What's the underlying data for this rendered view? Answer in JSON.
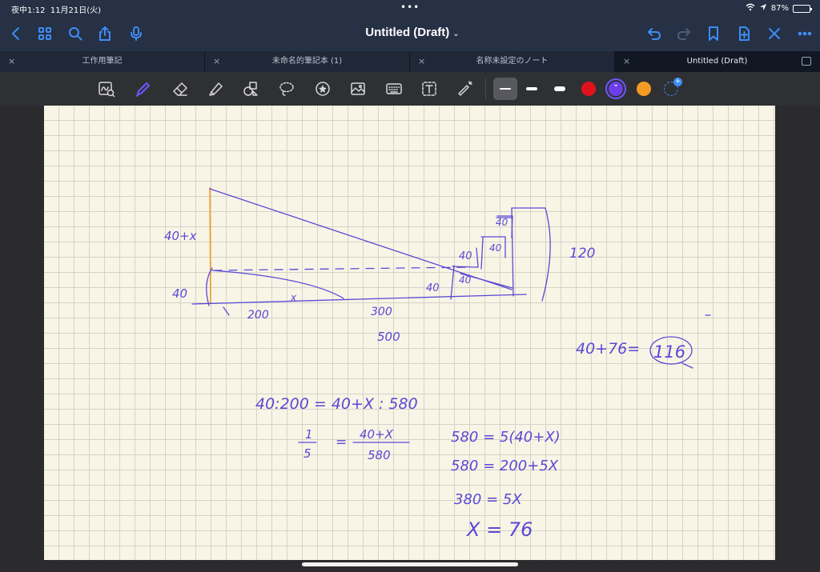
{
  "status": {
    "time": "夜中1:12",
    "date": "11月21日(火)",
    "battery": "87%",
    "battery_level": 0.87,
    "dots": "•••"
  },
  "nav": {
    "title": "Untitled (Draft)",
    "chevron": "⌄"
  },
  "tabs": [
    {
      "label": "工作用筆記",
      "close": "×"
    },
    {
      "label": "未命名的筆記本 (1)",
      "close": "×"
    },
    {
      "label": "名称未設定のノート",
      "close": "×"
    },
    {
      "label": "Untitled (Draft)",
      "close": "×"
    }
  ],
  "colors": {
    "accent": "#3e8cf4",
    "ink": "#5a49d6",
    "red": "#e0121b",
    "purple": "#6b3ee8",
    "orange": "#f59a23",
    "paper": "#f8f5e6"
  },
  "icons": [
    "back-icon",
    "grid-icon",
    "search-icon",
    "share-icon",
    "mic-icon",
    "undo-icon",
    "redo-icon",
    "bookmark-icon",
    "add-page-icon",
    "close-icon",
    "more-icon"
  ],
  "note": {
    "labels": {
      "h40x": "40+x",
      "h40": "40",
      "d200": "200",
      "x": "x",
      "d300": "300",
      "d500": "500",
      "w40a": "40",
      "w40b": "40",
      "w40c": "40",
      "w40d": "40",
      "w40e": "40",
      "w120": "120",
      "sum": "40+76=",
      "result": "116"
    },
    "equations": [
      "40:200 = 40+X : 580",
      "1/5 = 40+X / 580",
      "580 = 5(40+X)",
      "580 = 200+5X",
      "380 = 5X",
      "X = 76"
    ],
    "frac": {
      "num1": "1",
      "den1": "5",
      "eq": "=",
      "num2": "40+X",
      "den2": "580"
    }
  }
}
